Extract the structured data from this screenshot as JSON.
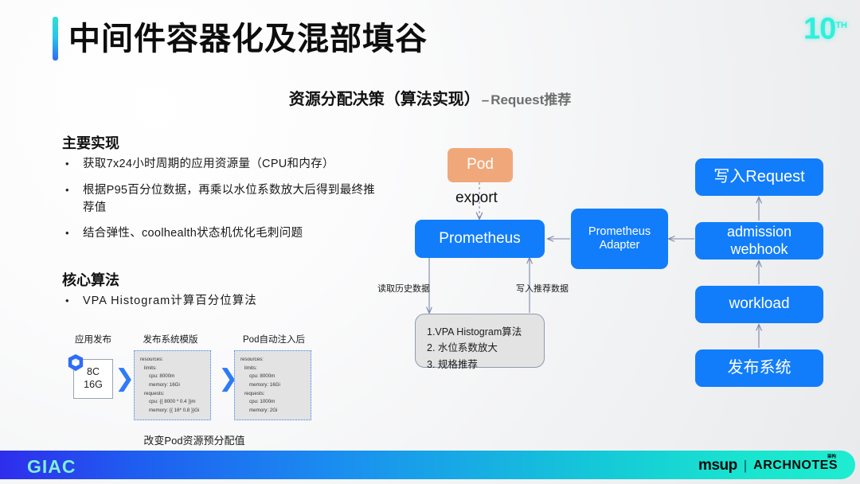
{
  "header": {
    "title": "中间件容器化及混部填谷",
    "anniversary": "10",
    "anniversary_sup": "TH",
    "subtitle_main": "资源分配决策（算法实现）",
    "subtitle_dash": "–",
    "subtitle_sub": "Request推荐"
  },
  "left": {
    "section1_title": "主要实现",
    "bullet_marker": "•",
    "bullets1": [
      "获取7x24小时周期的应用资源量（CPU和内存）",
      "根据P95百分位数据，再乘以水位系数放大后得到最终推荐值",
      "结合弹性、coolhealth状态机优化毛刺问题"
    ],
    "section2_title": "核心算法",
    "bullets2": [
      "VPA Histogram计算百分位算法"
    ]
  },
  "mini_diagram": {
    "cap_left": "应用发布",
    "cap_mid": "发布系统模版",
    "cap_right": "Pod自动注入后",
    "spec_cpu": "8C",
    "spec_mem": "16G",
    "icon_name": "container-cube-icon",
    "arrow_glyph": "❯",
    "template_code": [
      "resources:",
      "limits:",
      "cpu: 8000m",
      "memory: 16Gi",
      "requests:",
      "cpu: {{ 8000 * 0.4 }}m",
      "memory: {{ 16* 0.8 }}Gi"
    ],
    "injected_code": [
      "resources:",
      "limits:",
      "cpu: 8000m",
      "memory: 16Gi",
      "requests:",
      "cpu:  1000m",
      "memory: 2Gi"
    ],
    "footer_caption": "改变Pod资源预分配值"
  },
  "flow": {
    "pod": "Pod",
    "export_label": "export",
    "prometheus": "Prometheus",
    "prometheus_adapter_l1": "Prometheus",
    "prometheus_adapter_l2": "Adapter",
    "write_request": "写入Request",
    "admission_l1": "admission",
    "admission_l2": "webhook",
    "workload": "workload",
    "release_system": "发布系统",
    "edge_read": "读取历史数据",
    "edge_write": "写入推荐数据",
    "algo_lines": [
      "1.VPA Histogram算法",
      "2. 水位系数放大",
      "3. 规格推荐"
    ]
  },
  "footer": {
    "giac": "GIAC",
    "msup": "msup",
    "separator": "|",
    "archnotes": "ARCHNOTES",
    "archnotes_cn": "架构"
  },
  "colors": {
    "accent_teal": "#2fe0d0",
    "accent_blue": "#2f6bf0",
    "node_blue": "#127dfa",
    "node_pod": "#f0a87a",
    "algo_gray": "#e3e3e3"
  }
}
